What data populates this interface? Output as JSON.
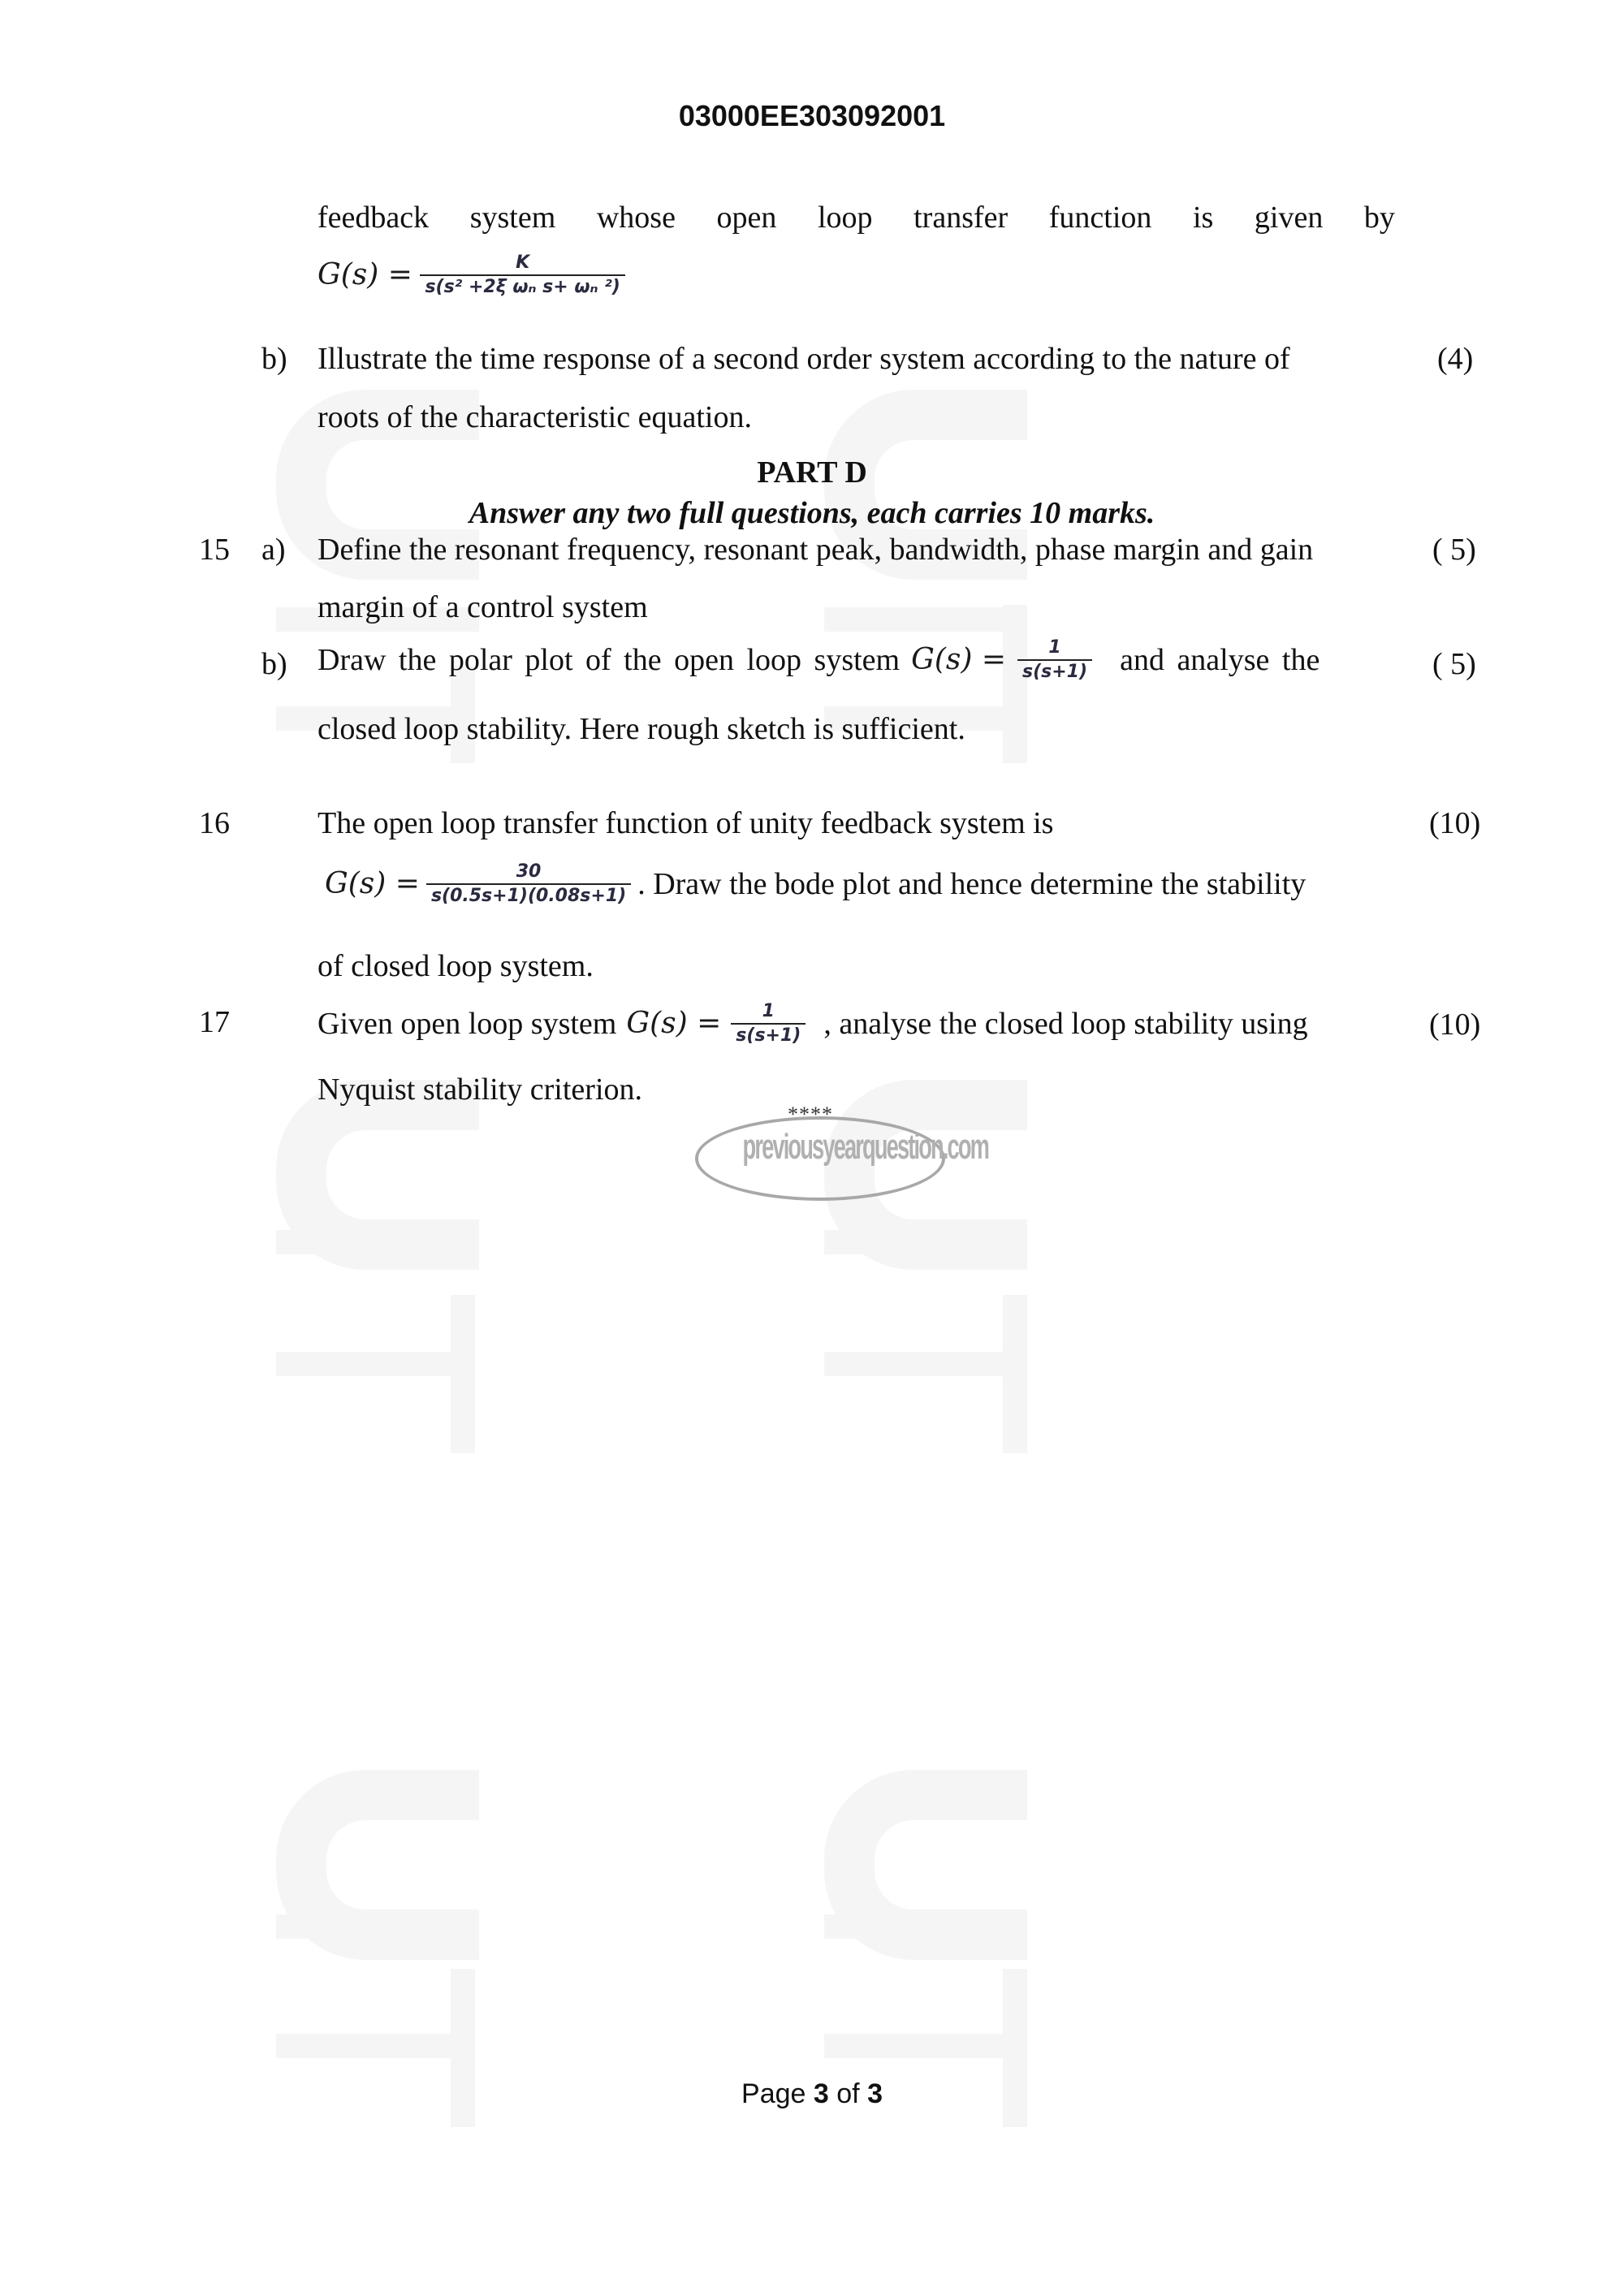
{
  "header": {
    "paper_code": "03000EE303092001"
  },
  "q14_continued": {
    "line1_words": [
      "feedback",
      "system",
      "whose",
      "open",
      "loop",
      "transfer",
      "function",
      "is",
      "given",
      "by"
    ],
    "equation": {
      "lhs": "G(s) =",
      "numerator": "K",
      "denominator": "s(s² +2ξ ωₙ s+ ωₙ ²)"
    },
    "b": {
      "label": "b)",
      "line1": "Illustrate the time response of a second order system according to the nature of",
      "line2": "roots of the characteristic equation.",
      "marks": "(4)"
    }
  },
  "part_d": {
    "title": "PART D",
    "instruction": "Answer any two full questions, each carries 10 marks."
  },
  "questions": {
    "q15": {
      "number": "15",
      "a": {
        "label": "a)",
        "line1": "Define the resonant frequency, resonant peak, bandwidth, phase margin and gain",
        "line2": "margin of a control system",
        "marks": "( 5)"
      },
      "b": {
        "label": "b)",
        "line1_pre": "Draw the polar plot of the open loop system",
        "equation": {
          "lhs": "G(s) =",
          "numerator": "1",
          "denominator": "s(s+1)"
        },
        "line1_post": "and analyse the",
        "line2": "closed loop stability. Here rough sketch is sufficient.",
        "marks": "( 5)"
      }
    },
    "q16": {
      "number": "16",
      "line1": "The open loop transfer function of unity feedback system is",
      "equation": {
        "lhs": "G(s) =",
        "numerator": "30",
        "denominator": "s(0.5s+1)(0.08s+1)"
      },
      "line2_post": ". Draw the bode plot and hence determine the stability",
      "line3": "of closed loop system.",
      "marks": "(10)"
    },
    "q17": {
      "number": "17",
      "line1_pre": "Given open loop system",
      "equation": {
        "lhs": "G(s) =",
        "numerator": "1",
        "denominator": "s(s+1)"
      },
      "line1_post": ", analyse the closed loop stability using",
      "line2": "Nyquist stability criterion.",
      "marks": "(10)"
    }
  },
  "end_marker": "****",
  "stamp": {
    "text": "previousyearquestion.com"
  },
  "footer": {
    "prefix": "Page",
    "current": "3",
    "middle": "of",
    "total": "3"
  },
  "watermark": {
    "text": "CIT",
    "color": "#f5f5f5"
  }
}
